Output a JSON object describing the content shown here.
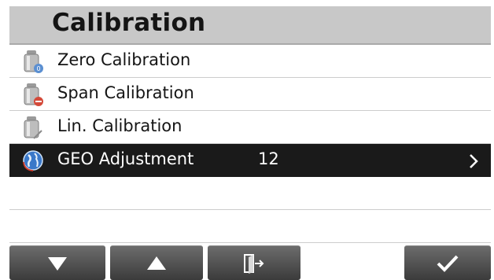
{
  "header": {
    "title": "Calibration"
  },
  "menu": {
    "items": [
      {
        "label": "Zero Calibration",
        "icon": "zero-calibration-weight-icon"
      },
      {
        "label": "Span Calibration",
        "icon": "span-calibration-weight-icon"
      },
      {
        "label": "Lin. Calibration",
        "icon": "linearity-calibration-weight-icon"
      },
      {
        "label": "GEO Adjustment",
        "value": "12",
        "icon": "globe-icon",
        "selected": true
      }
    ]
  },
  "toolbar": {
    "buttons": [
      "down-arrow-icon",
      "up-arrow-icon",
      "exit-icon",
      "checkmark-icon"
    ]
  },
  "colors": {
    "header_bg": "#c8c8c8",
    "selected_bg": "#1a1a1a",
    "button_bg": "#4f4f4f"
  }
}
